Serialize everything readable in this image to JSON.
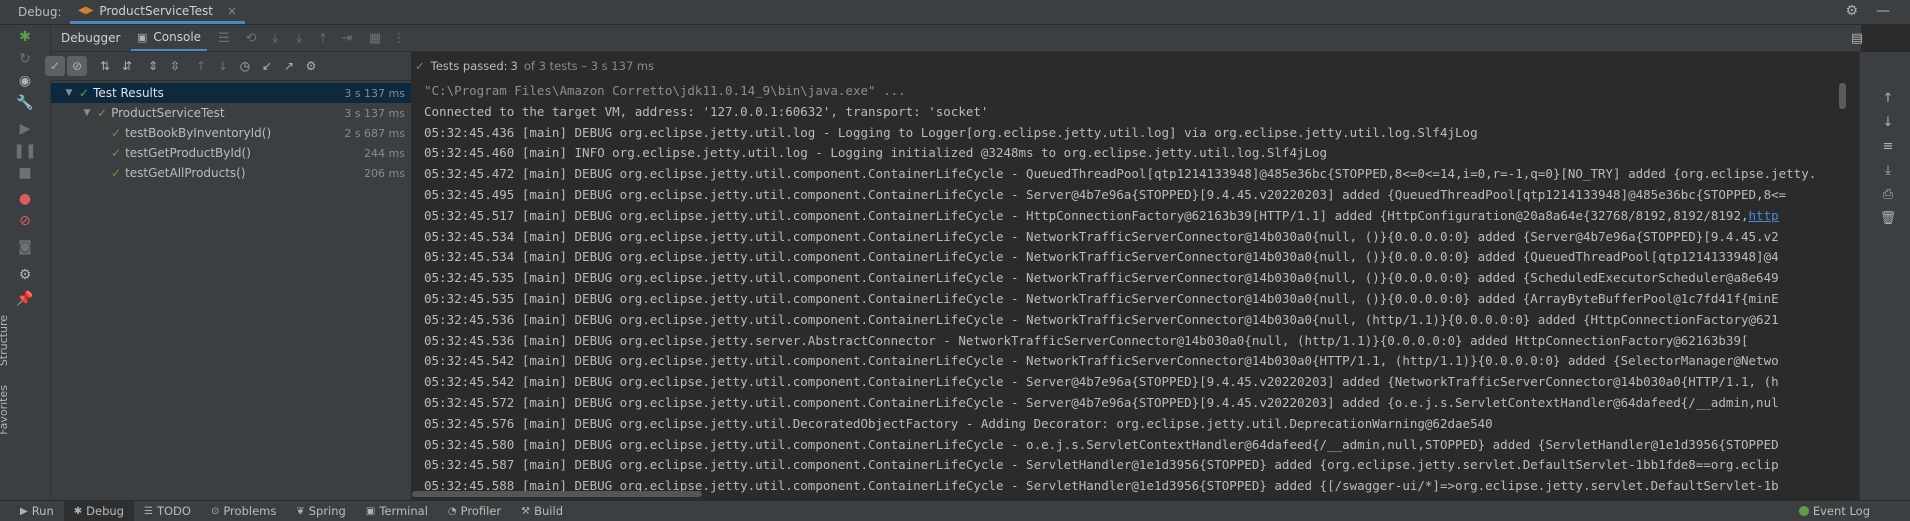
{
  "top": {
    "debug_label": "Debug:",
    "run_tab": "ProductServiceTest",
    "close": "×"
  },
  "tabs": {
    "debugger": "Debugger",
    "console": "Console"
  },
  "status": {
    "label": "Tests passed:",
    "count": "3",
    "detail": "of 3 tests – 3 s 137 ms"
  },
  "tree": [
    {
      "label": "Test Results",
      "time": "3 s 137 ms"
    },
    {
      "label": "ProductServiceTest",
      "time": "3 s 137 ms"
    },
    {
      "label": "testBookByInventoryId()",
      "time": "2 s 687 ms"
    },
    {
      "label": "testGetProductById()",
      "time": "244 ms"
    },
    {
      "label": "testGetAllProducts()",
      "time": "206 ms"
    }
  ],
  "console": {
    "lines": [
      "\"C:\\Program Files\\Amazon Corretto\\jdk11.0.14_9\\bin\\java.exe\" ...",
      "Connected to the target VM, address: '127.0.0.1:60632', transport: 'socket'",
      "05:32:45.436 [main] DEBUG org.eclipse.jetty.util.log - Logging to Logger[org.eclipse.jetty.util.log] via org.eclipse.jetty.util.log.Slf4jLog",
      "05:32:45.460 [main] INFO org.eclipse.jetty.util.log - Logging initialized @3248ms to org.eclipse.jetty.util.log.Slf4jLog",
      "05:32:45.472 [main] DEBUG org.eclipse.jetty.util.component.ContainerLifeCycle - QueuedThreadPool[qtp1214133948]@485e36bc{STOPPED,8<=0<=14,i=0,r=-1,q=0}[NO_TRY] added {org.eclipse.jetty.",
      "05:32:45.495 [main] DEBUG org.eclipse.jetty.util.component.ContainerLifeCycle - Server@4b7e96a{STOPPED}[9.4.45.v20220203] added {QueuedThreadPool[qtp1214133948]@485e36bc{STOPPED,8<=",
      "05:32:45.517 [main] DEBUG org.eclipse.jetty.util.component.ContainerLifeCycle - HttpConnectionFactory@62163b39[HTTP/1.1] added {HttpConfiguration@20a8a64e{32768/8192,8192/8192,",
      "05:32:45.534 [main] DEBUG org.eclipse.jetty.util.component.ContainerLifeCycle - NetworkTrafficServerConnector@14b030a0{null, ()}{0.0.0.0:0} added {Server@4b7e96a{STOPPED}[9.4.45.v2",
      "05:32:45.534 [main] DEBUG org.eclipse.jetty.util.component.ContainerLifeCycle - NetworkTrafficServerConnector@14b030a0{null, ()}{0.0.0.0:0} added {QueuedThreadPool[qtp1214133948]@4",
      "05:32:45.535 [main] DEBUG org.eclipse.jetty.util.component.ContainerLifeCycle - NetworkTrafficServerConnector@14b030a0{null, ()}{0.0.0.0:0} added {ScheduledExecutorScheduler@a8e649",
      "05:32:45.535 [main] DEBUG org.eclipse.jetty.util.component.ContainerLifeCycle - NetworkTrafficServerConnector@14b030a0{null, ()}{0.0.0.0:0} added {ArrayByteBufferPool@1c7fd41f{minE",
      "05:32:45.536 [main] DEBUG org.eclipse.jetty.util.component.ContainerLifeCycle - NetworkTrafficServerConnector@14b030a0{null, (http/1.1)}{0.0.0.0:0} added {HttpConnectionFactory@621",
      "05:32:45.536 [main] DEBUG org.eclipse.jetty.server.AbstractConnector - NetworkTrafficServerConnector@14b030a0{null, (http/1.1)}{0.0.0.0:0} added HttpConnectionFactory@62163b39[",
      "05:32:45.542 [main] DEBUG org.eclipse.jetty.util.component.ContainerLifeCycle - NetworkTrafficServerConnector@14b030a0{HTTP/1.1, (http/1.1)}{0.0.0.0:0} added {SelectorManager@Netwo",
      "05:32:45.542 [main] DEBUG org.eclipse.jetty.util.component.ContainerLifeCycle - Server@4b7e96a{STOPPED}[9.4.45.v20220203] added {NetworkTrafficServerConnector@14b030a0{HTTP/1.1, (h",
      "05:32:45.572 [main] DEBUG org.eclipse.jetty.util.component.ContainerLifeCycle - Server@4b7e96a{STOPPED}[9.4.45.v20220203] added {o.e.j.s.ServletContextHandler@64dafeed{/__admin,nul",
      "05:32:45.576 [main] DEBUG org.eclipse.jetty.util.DecoratedObjectFactory - Adding Decorator: org.eclipse.jetty.util.DeprecationWarning@62dae540",
      "05:32:45.580 [main] DEBUG org.eclipse.jetty.util.component.ContainerLifeCycle - o.e.j.s.ServletContextHandler@64dafeed{/__admin,null,STOPPED} added {ServletHandler@1e1d3956{STOPPED",
      "05:32:45.587 [main] DEBUG org.eclipse.jetty.util.component.ContainerLifeCycle - ServletHandler@1e1d3956{STOPPED} added {org.eclipse.jetty.servlet.DefaultServlet-1bb1fde8==org.eclip",
      "05:32:45.588 [main] DEBUG org.eclipse.jetty.util.component.ContainerLifeCycle - ServletHandler@1e1d3956{STOPPED} added {[/swagger-ui/*]=>org.eclipse.jetty.servlet.DefaultServlet-1b"
    ],
    "link_text": "http"
  },
  "left_sidebar": {
    "structure": "Structure",
    "favorites": "Favorites"
  },
  "bottom": {
    "tabs": [
      "Run",
      "Debug",
      "TODO",
      "Problems",
      "Spring",
      "Terminal",
      "Profiler",
      "Build"
    ],
    "event_log": "Event Log"
  },
  "colors": {
    "accent": "#4a88c7",
    "pass": "#5f9e46",
    "selection": "#0d293e"
  }
}
